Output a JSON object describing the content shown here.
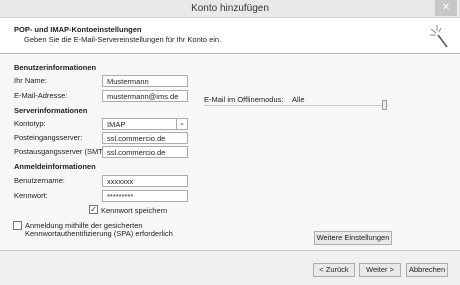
{
  "window": {
    "title": "Konto hinzufügen",
    "close_glyph": "✕"
  },
  "header": {
    "title": "POP- und IMAP-Kontoeinstellungen",
    "subtitle": "Geben Sie die E-Mail-Servereinstellungen für Ihr Konto ein.",
    "icon": "magic-wand-icon"
  },
  "sections": {
    "user_info": "Benutzerinformationen",
    "server_info": "Serverinformationen",
    "login_info": "Anmeldeinformationen"
  },
  "fields": {
    "name": {
      "label": "Ihr Name:",
      "value": "Mustermann"
    },
    "email": {
      "label": "E-Mail-Adresse:",
      "value": "mustermann@ims.de"
    },
    "account_type": {
      "label": "Kontotyp:",
      "value": "IMAP"
    },
    "incoming": {
      "label": "Posteingangsserver:",
      "value": "ssl.commercio.de"
    },
    "outgoing": {
      "label": "Postausgangsserver (SMTP):",
      "value": "ssl.commercio.de"
    },
    "username": {
      "label": "Benutzername:",
      "value": "xxxxxxx"
    },
    "password": {
      "label": "Kennwort:",
      "value": "*********"
    }
  },
  "remember_password": {
    "label": "Kennwort speichern",
    "checked": true
  },
  "spa": {
    "line1": "Anmeldung mithilfe der gesicherten",
    "line2": "Kennwortauthentifizierung (SPA) erforderlich",
    "checked": false
  },
  "offline": {
    "label": "E-Mail im Offlinemodus:",
    "value": "Alle",
    "level": 1.0
  },
  "buttons": {
    "more_settings": "Weitere Einstellungen",
    "back": "< Zurück",
    "next": "Weiter >",
    "cancel": "Abbrechen"
  }
}
